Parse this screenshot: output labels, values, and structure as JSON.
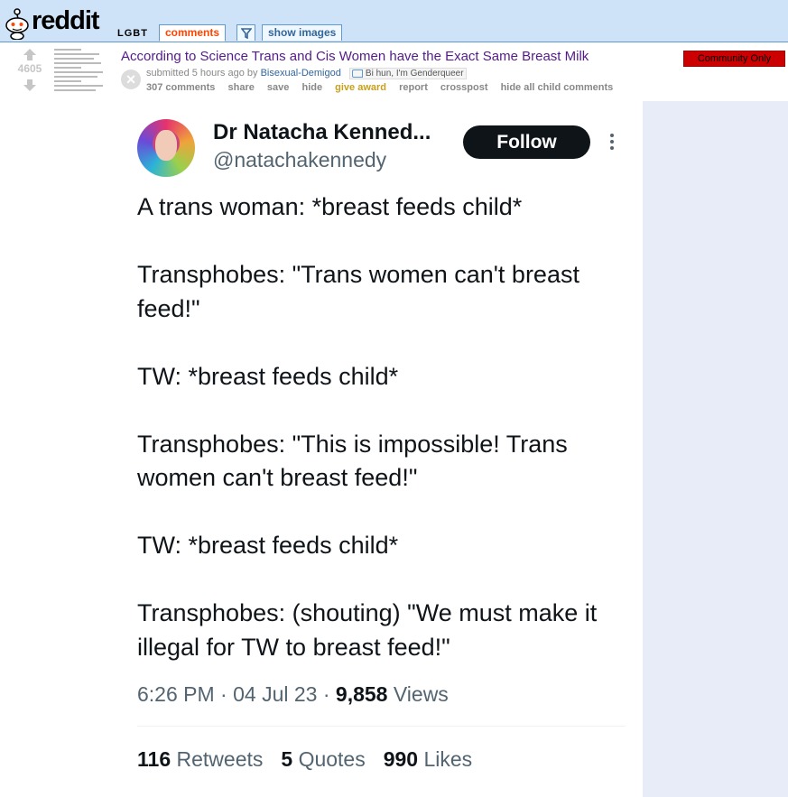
{
  "header": {
    "logo_text": "reddit",
    "subreddit": "LGBT",
    "tabs": {
      "comments": "comments",
      "show_images": "show images"
    },
    "filter_icon": "filter-icon"
  },
  "post": {
    "score": "4605",
    "title": "According to Science Trans and Cis Women have the Exact Same Breast Milk",
    "flair": "Community Only",
    "tagline": {
      "prefix": "submitted 5 hours ago by",
      "author": "Bisexual-Demigod",
      "user_flair": "Bi hun, I'm Genderqueer"
    },
    "buttons": [
      "307 comments",
      "share",
      "save",
      "hide",
      "give award",
      "report",
      "crosspost",
      "hide all child comments"
    ],
    "hide_icon": "×"
  },
  "tweet": {
    "name": "Dr Natacha Kenned...",
    "handle": "@natachakennedy",
    "follow_label": "Follow",
    "lines": [
      "A trans woman: *breast feeds child*",
      "Transphobes: \"Trans women can't breast feed!\"",
      "TW: *breast feeds child*",
      "Transphobes: \"This is impossible! Trans women can't breast feed!\"",
      "TW: *breast feeds child*",
      "Transphobes: (shouting) \"We must make it illegal for TW to breast feed!\""
    ],
    "time": "6:26 PM",
    "date": "04 Jul 23",
    "views_count": "9,858",
    "views_label": "Views",
    "retweets_count": "116",
    "retweets_label": "Retweets",
    "quotes_count": "5",
    "quotes_label": "Quotes",
    "likes_count": "990",
    "likes_label": "Likes"
  },
  "colors": {
    "header_bg": "#cee3f8",
    "title_link": "#551a8b",
    "flair_bg": "#cc0000",
    "follow_bg": "#0f1419"
  }
}
